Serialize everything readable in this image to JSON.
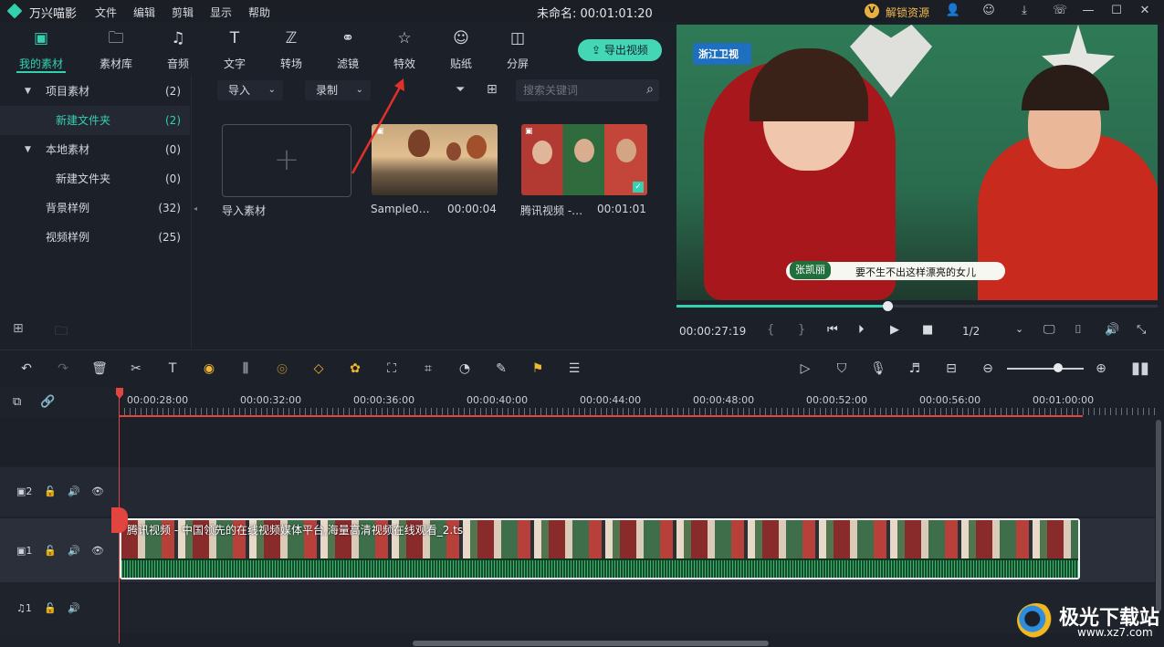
{
  "titlebar": {
    "app_name": "万兴喵影",
    "menus": [
      "文件",
      "编辑",
      "剪辑",
      "显示",
      "帮助"
    ],
    "doc_title": "未命名: 00:01:01:20",
    "unlock_label": "解锁资源",
    "unlock_badge": "V"
  },
  "tabs": [
    {
      "label": "我的素材",
      "icon": "media-box-icon",
      "active": true
    },
    {
      "label": "素材库",
      "icon": "folder-icon"
    },
    {
      "label": "音频",
      "icon": "music-note-icon"
    },
    {
      "label": "文字",
      "icon": "text-icon"
    },
    {
      "label": "转场",
      "icon": "transition-icon"
    },
    {
      "label": "滤镜",
      "icon": "filter-icon"
    },
    {
      "label": "特效",
      "icon": "effects-star-icon"
    },
    {
      "label": "贴纸",
      "icon": "sticker-icon"
    },
    {
      "label": "分屏",
      "icon": "split-screen-icon"
    }
  ],
  "export_button": "导出视频",
  "tree": [
    {
      "label": "项目素材",
      "count": "(2)",
      "expanded": true
    },
    {
      "label": "新建文件夹",
      "count": "(2)",
      "selected": true
    },
    {
      "label": "本地素材",
      "count": "(0)",
      "expanded": true
    },
    {
      "label": "新建文件夹",
      "count": "(0)"
    },
    {
      "label": "背景样例",
      "count": "(32)"
    },
    {
      "label": "视频样例",
      "count": "(25)"
    }
  ],
  "media": {
    "import_dropdown": "导入",
    "record_dropdown": "录制",
    "search_placeholder": "搜索关键词",
    "import_tile_label": "导入素材",
    "items": [
      {
        "name": "Sample0…",
        "duration": "00:00:04"
      },
      {
        "name": "腾讯视频 -…",
        "duration": "00:01:01"
      }
    ]
  },
  "preview": {
    "current_time": "00:00:27:19",
    "page": "1/2",
    "progress": 0.44,
    "channel_logo": "浙江卫视",
    "caption_name": "张凯丽",
    "caption_text": "要不生不出这样漂亮的女儿"
  },
  "timeline": {
    "ruler_labels": [
      "00:00:28:00",
      "00:00:32:00",
      "00:00:36:00",
      "00:00:40:00",
      "00:00:44:00",
      "00:00:48:00",
      "00:00:52:00",
      "00:00:56:00",
      "00:01:00:00"
    ],
    "tracks": [
      {
        "label": "2",
        "type": "video"
      },
      {
        "label": "1",
        "type": "video"
      },
      {
        "label": "1",
        "type": "audio"
      }
    ],
    "clip_title": "腾讯视频 - 中国领先的在线视频媒体平台,海量高清视频在线观看_2.ts",
    "zoom_level": 0.62
  },
  "watermark": {
    "text": "极光下载站",
    "url": "www.xz7.com"
  }
}
